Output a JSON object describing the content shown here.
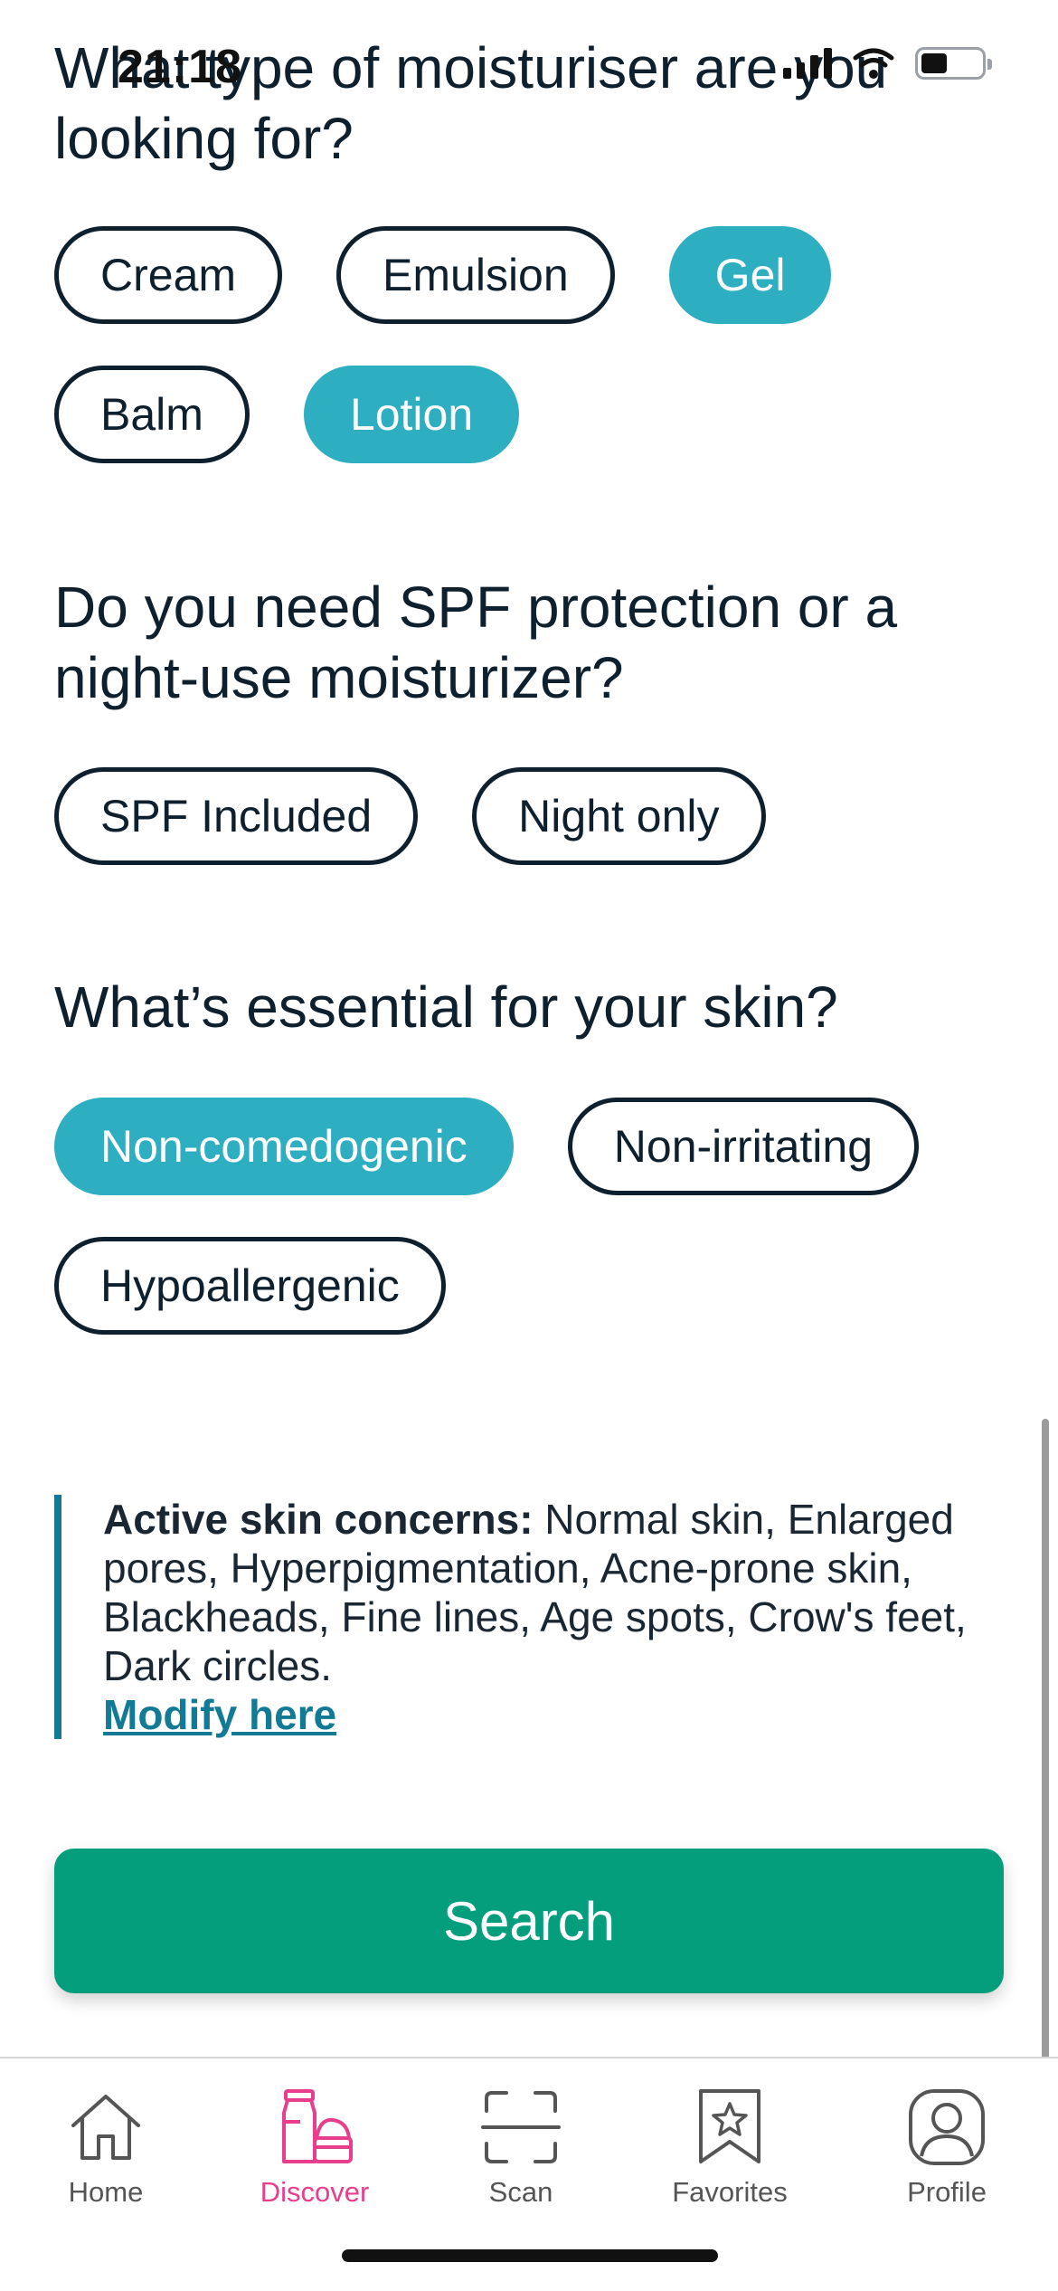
{
  "status": {
    "time": "21:18"
  },
  "questions": {
    "type": {
      "title": "What type of moisturiser are you looking for?",
      "options": [
        {
          "label": "Cream",
          "selected": false
        },
        {
          "label": "Emulsion",
          "selected": false
        },
        {
          "label": "Gel",
          "selected": true
        },
        {
          "label": "Balm",
          "selected": false
        },
        {
          "label": "Lotion",
          "selected": true
        }
      ]
    },
    "spf": {
      "title": "Do you need SPF protection or a night-use moisturizer?",
      "options": [
        {
          "label": "SPF Included",
          "selected": false
        },
        {
          "label": "Night only",
          "selected": false
        }
      ]
    },
    "essential": {
      "title": "What’s essential for your skin?",
      "options": [
        {
          "label": "Non-comedogenic",
          "selected": true
        },
        {
          "label": "Non-irritating",
          "selected": false
        },
        {
          "label": "Hypoallergenic",
          "selected": false
        }
      ]
    }
  },
  "concerns": {
    "label": "Active skin concerns:",
    "text": " Normal skin, Enlarged pores, Hyperpigmentation, Acne-prone skin, Blackheads, Fine lines, Age spots, Crow's feet, Dark circles.",
    "link": "Modify here"
  },
  "search_button": "Search",
  "tabs": [
    {
      "label": "Home",
      "icon": "home-icon",
      "active": false
    },
    {
      "label": "Discover",
      "icon": "discover-icon",
      "active": true
    },
    {
      "label": "Scan",
      "icon": "scan-icon",
      "active": false
    },
    {
      "label": "Favorites",
      "icon": "favorites-icon",
      "active": false
    },
    {
      "label": "Profile",
      "icon": "profile-icon",
      "active": false
    }
  ],
  "colors": {
    "selected_chip": "#2eaec1",
    "search_button": "#049e7d",
    "link": "#127a95",
    "active_tab": "#e83e8c",
    "text": "#0e1f2e"
  }
}
